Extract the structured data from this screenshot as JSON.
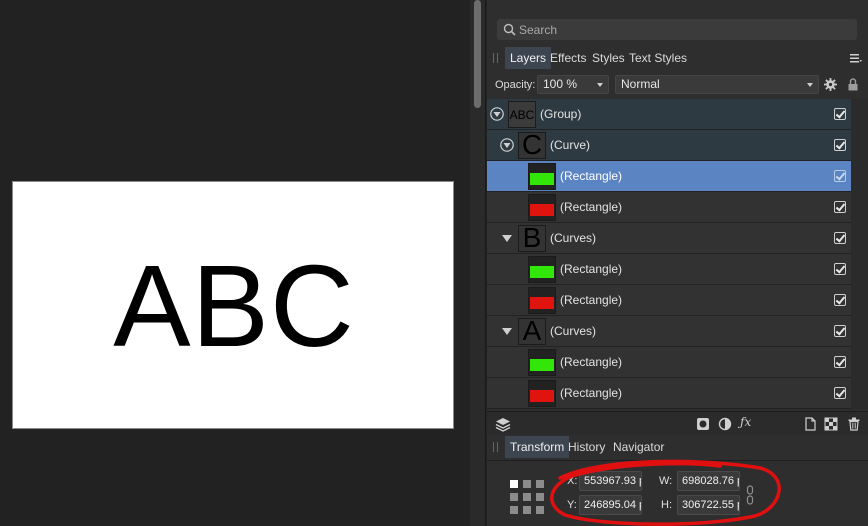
{
  "canvas": {
    "artboard_text": "ABC"
  },
  "search": {
    "placeholder": "Search"
  },
  "panel_tabs": [
    {
      "label": "Layers",
      "active": true
    },
    {
      "label": "Effects",
      "active": false
    },
    {
      "label": "Styles",
      "active": false
    },
    {
      "label": "Text Styles",
      "active": false
    }
  ],
  "opacity": {
    "label": "Opacity:",
    "value": "100 %",
    "blend_mode": "Normal"
  },
  "layers": [
    {
      "name": "(Group)",
      "thumb_text": "ABC",
      "kind": "group",
      "visible": true
    },
    {
      "name": "(Curve)",
      "thumb_text": "C",
      "kind": "curve",
      "visible": true
    },
    {
      "name": "(Rectangle)",
      "color": "#33e60a",
      "selected": true,
      "visible": true
    },
    {
      "name": "(Rectangle)",
      "color": "#e0140e",
      "visible": true
    },
    {
      "name": "(Curves)",
      "thumb_text": "B",
      "kind": "curves",
      "visible": true
    },
    {
      "name": "(Rectangle)",
      "color": "#33e60a",
      "visible": true
    },
    {
      "name": "(Rectangle)",
      "color": "#e0140e",
      "visible": true
    },
    {
      "name": "(Curves)",
      "thumb_text": "A",
      "kind": "curves",
      "visible": true
    },
    {
      "name": "(Rectangle)",
      "color": "#33e60a",
      "visible": true
    },
    {
      "name": "(Rectangle)",
      "color": "#e0140e",
      "visible": true
    }
  ],
  "bottom_tabs": [
    {
      "label": "Transform",
      "active": true
    },
    {
      "label": "History",
      "active": false
    },
    {
      "label": "Navigator",
      "active": false
    }
  ],
  "transform": {
    "x_label": "X:",
    "x_value": "553967.93 p",
    "y_label": "Y:",
    "y_value": "246895.04 p",
    "w_label": "W:",
    "w_value": "698028.76 p",
    "h_label": "H:",
    "h_value": "306722.55 p"
  },
  "colors": {
    "selection": "#5b84c3",
    "annotation": "#e01010",
    "green_swatch": "#33e60a",
    "red_swatch": "#e0140e"
  },
  "icons": [
    "search-icon",
    "panel-menu-icon",
    "gear-icon",
    "lock-icon",
    "layers-icon",
    "mask-icon",
    "adjustment-icon",
    "fx-icon",
    "new-layer-icon",
    "checker-icon",
    "trash-icon",
    "link-icon"
  ]
}
